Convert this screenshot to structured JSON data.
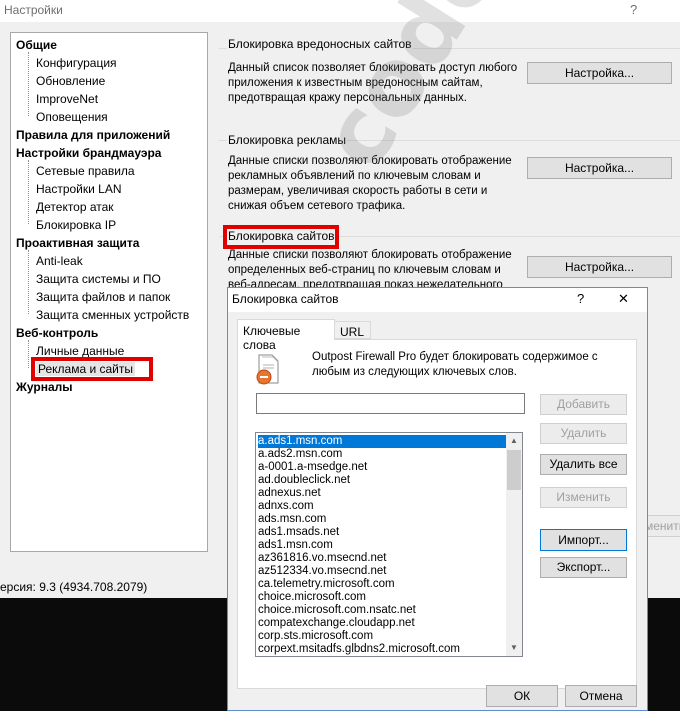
{
  "window": {
    "title": "Настройки",
    "help": "?"
  },
  "tree": {
    "items": [
      {
        "label": "Общие",
        "level": 0
      },
      {
        "label": "Конфигурация",
        "level": 1
      },
      {
        "label": "Обновление",
        "level": 1
      },
      {
        "label": "ImproveNet",
        "level": 1
      },
      {
        "label": "Оповещения",
        "level": 1
      },
      {
        "label": "Правила для приложений",
        "level": 0
      },
      {
        "label": "Настройки брандмауэра",
        "level": 0
      },
      {
        "label": "Сетевые правила",
        "level": 1
      },
      {
        "label": "Настройки LAN",
        "level": 1
      },
      {
        "label": "Детектор атак",
        "level": 1
      },
      {
        "label": "Блокировка IP",
        "level": 1
      },
      {
        "label": "Проактивная защита",
        "level": 0
      },
      {
        "label": "Anti-leak",
        "level": 1
      },
      {
        "label": "Защита системы и ПО",
        "level": 1
      },
      {
        "label": "Защита файлов и папок",
        "level": 1
      },
      {
        "label": "Защита сменных устройств",
        "level": 1
      },
      {
        "label": "Веб-контроль",
        "level": 0
      },
      {
        "label": "Личные данные",
        "level": 1
      },
      {
        "label": "Реклама и сайты",
        "level": 1,
        "selected": true
      },
      {
        "label": "Журналы",
        "level": 0
      }
    ]
  },
  "groups": [
    {
      "title": "Блокировка вредоносных сайтов",
      "desc": "Данный список позволяет блокировать доступ любого приложения к известным вредоносным сайтам, предотвращая кражу персональных данных.",
      "button": "Настройка..."
    },
    {
      "title": "Блокировка рекламы",
      "desc": "Данные списки позволяют блокировать отображение рекламных объявлений по ключевым словам и размерам, увеличивая скорость работы в сети и снижая объем сетевого трафика.",
      "button": "Настройка..."
    },
    {
      "title": "Блокировка сайтов",
      "desc": "Данные списки позволяют блокировать отображение определенных веб-страниц по ключевым словам и веб-адресам, предотвращая показ нежелательного",
      "button": "Настройка..."
    }
  ],
  "partial_button": "менить",
  "version": "ерсия: 9.3 (4934.708.2079)",
  "watermark": "codeby.net",
  "dialog": {
    "title": "Блокировка сайтов",
    "help": "?",
    "close": "✕",
    "tabs": [
      "Ключевые слова",
      "URL"
    ],
    "info": "Outpost Firewall Pro будет блокировать содержимое с любым из следующих ключевых слов.",
    "input_value": "",
    "buttons": {
      "add": "Добавить",
      "remove": "Удалить",
      "remove_all": "Удалить все",
      "edit": "Изменить",
      "import": "Импорт...",
      "export": "Экспорт...",
      "ok": "ОК",
      "cancel": "Отмена"
    },
    "list": [
      "a.ads1.msn.com",
      "a.ads2.msn.com",
      "a-0001.a-msedge.net",
      "ad.doubleclick.net",
      "adnexus.net",
      "adnxs.com",
      "ads.msn.com",
      "ads1.msads.net",
      "ads1.msn.com",
      "az361816.vo.msecnd.net",
      "az512334.vo.msecnd.net",
      "ca.telemetry.microsoft.com",
      "choice.microsoft.com",
      "choice.microsoft.com.nsatc.net",
      "compatexchange.cloudapp.net",
      "corp.sts.microsoft.com",
      "corpext.msitadfs.glbdns2.microsoft.com"
    ]
  },
  "colors": {
    "highlight_red": "#e00000",
    "selection_blue": "#0078d7"
  }
}
